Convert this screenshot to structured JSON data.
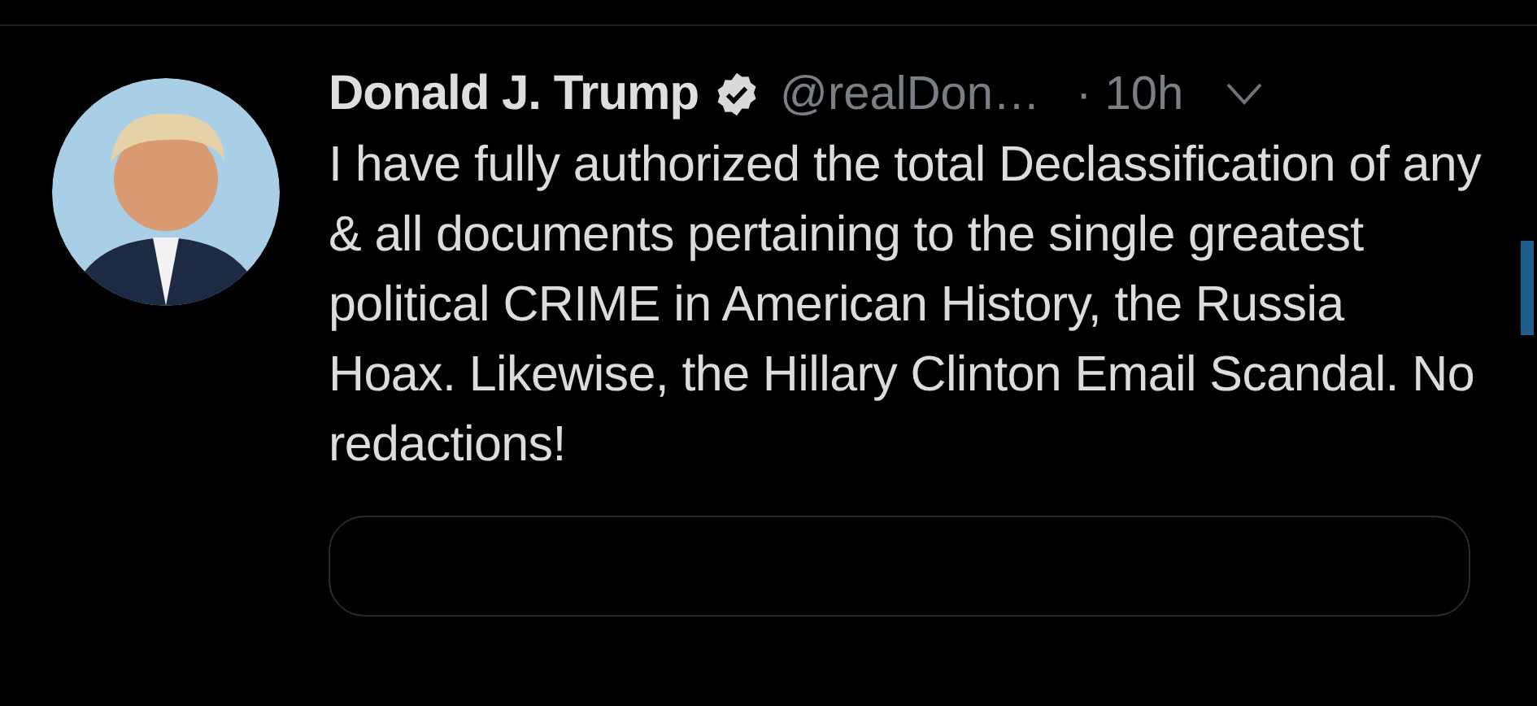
{
  "tweet": {
    "author": {
      "name": "Donald J. Trump",
      "verified": true,
      "handle": "@realDon…",
      "time": "· 10h"
    },
    "text": "I have fully authorized the total Declassification of any & all documents pertaining to the single greatest political CRIME in American History, the Russia Hoax. Likewise, the Hillary Clinton Email Scandal. No redactions!"
  }
}
